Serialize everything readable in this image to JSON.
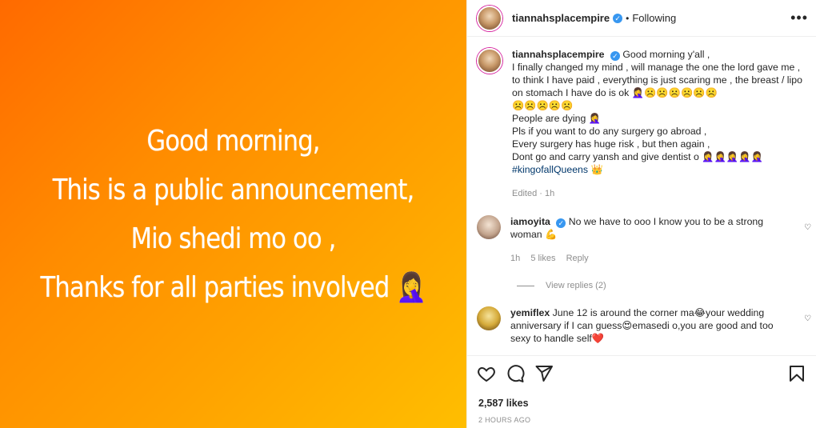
{
  "media": {
    "lines": [
      "Good morning,",
      "This is a public announcement,",
      "Mio shedi mo oo ,",
      "Thanks for all parties involved 🤦‍♀️"
    ]
  },
  "header": {
    "username": "tiannahsplacempire",
    "separator": "•",
    "follow_status": "Following",
    "more": "•••"
  },
  "caption": {
    "username": "tiannahsplacempire",
    "lines": [
      "Good morning y'all ,",
      "I finally changed my mind , will manage the one the lord gave me , to think I have paid , everything is just scaring me , the breast / lipo on stomach I have do is ok 🤦‍♀️☹️☹️☹️☹️☹️☹️",
      "☹️☹️☹️☹️☹️",
      "People are dying 🤦‍♀️",
      "Pls if you want to do any surgery go abroad ,",
      "Every surgery has huge risk , but then again ,",
      "Dont go and carry yansh and give dentist o 🤦‍♀️🤦‍♀️🤦‍♀️🤦‍♀️🤦‍♀️"
    ],
    "hashtag": "#kingofallQueens",
    "hashtag_emoji": "👑",
    "edited": "Edited · 1h"
  },
  "comments": [
    {
      "username": "iamoyita",
      "text": "No we have to ooo I know you to be a strong woman 💪",
      "time": "1h",
      "likes": "5 likes",
      "reply": "Reply"
    },
    {
      "username": "yemiflex",
      "text": "June 12 is around the corner ma😂your wedding anniversary if I can guess😍emasedi o,you are good and too sexy to handle self❤️"
    }
  ],
  "view_replies": "View replies (2)",
  "footer": {
    "likes": "2,587 likes",
    "time_ago": "2 HOURS AGO"
  }
}
